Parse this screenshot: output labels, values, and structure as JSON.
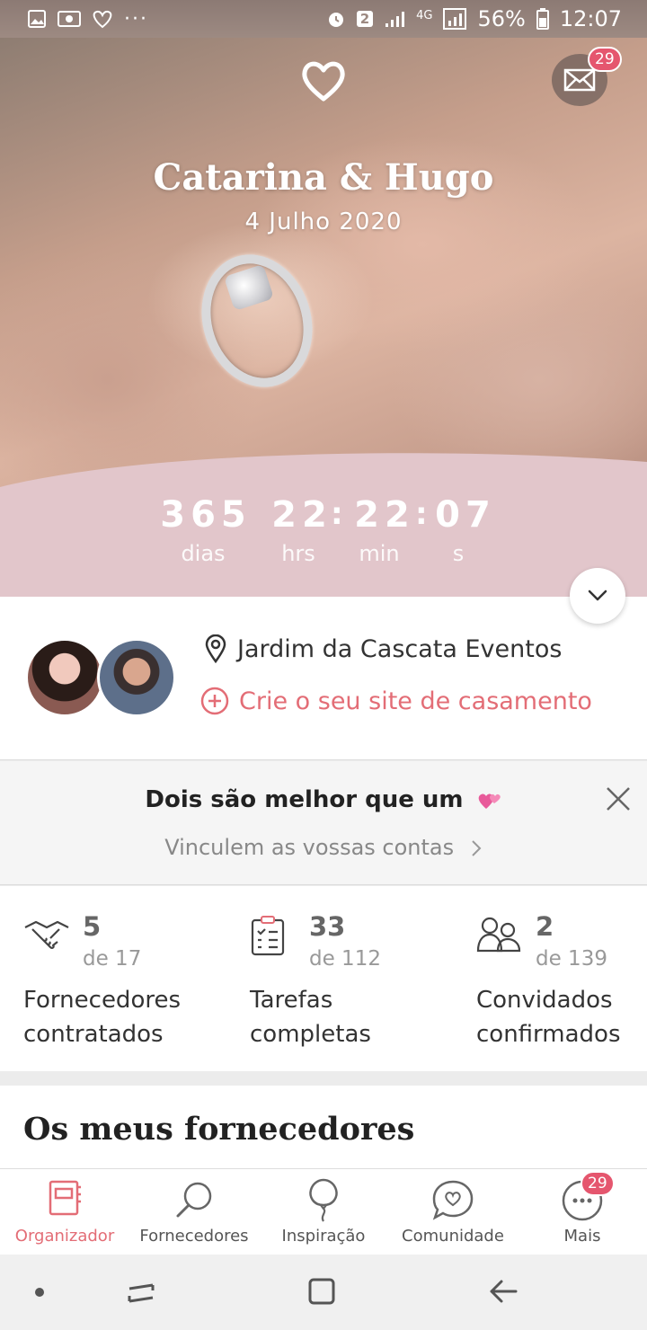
{
  "status_bar": {
    "battery": "56%",
    "time": "12:07",
    "sim": "2",
    "network": "4G"
  },
  "header": {
    "couple_names": "Catarina & Hugo",
    "wedding_date": "4 Julho 2020",
    "mail_badge": "29"
  },
  "countdown": {
    "days": "365",
    "hours": "22",
    "minutes": "22",
    "seconds": "07",
    "days_label": "dias",
    "hours_label": "hrs",
    "minutes_label": "min",
    "seconds_label": "s"
  },
  "venue": {
    "name": "Jardim da Cascata Eventos",
    "create_site_label": "Crie o seu site de casamento"
  },
  "link_banner": {
    "title": "Dois são melhor que um",
    "subtitle": "Vinculem as vossas contas"
  },
  "stats": [
    {
      "value": "5",
      "total": "de 17",
      "label_line1": "Fornecedores",
      "label_line2": "contratados"
    },
    {
      "value": "33",
      "total": "de 112",
      "label_line1": "Tarefas",
      "label_line2": "completas"
    },
    {
      "value": "2",
      "total": "de 139",
      "label_line1": "Convidados",
      "label_line2": "confirmados"
    }
  ],
  "suppliers_section": {
    "title": "Os meus fornecedores"
  },
  "tabs": [
    {
      "label": "Organizador",
      "icon": "planner-icon"
    },
    {
      "label": "Fornecedores",
      "icon": "search-icon"
    },
    {
      "label": "Inspiração",
      "icon": "balloon-icon"
    },
    {
      "label": "Comunidade",
      "icon": "chat-heart-icon"
    },
    {
      "label": "Mais",
      "icon": "more-icon",
      "badge": "29"
    }
  ],
  "colors": {
    "accent": "#e36d76",
    "countdown_bg": "#e2c6cb",
    "badge": "#e5566e"
  }
}
